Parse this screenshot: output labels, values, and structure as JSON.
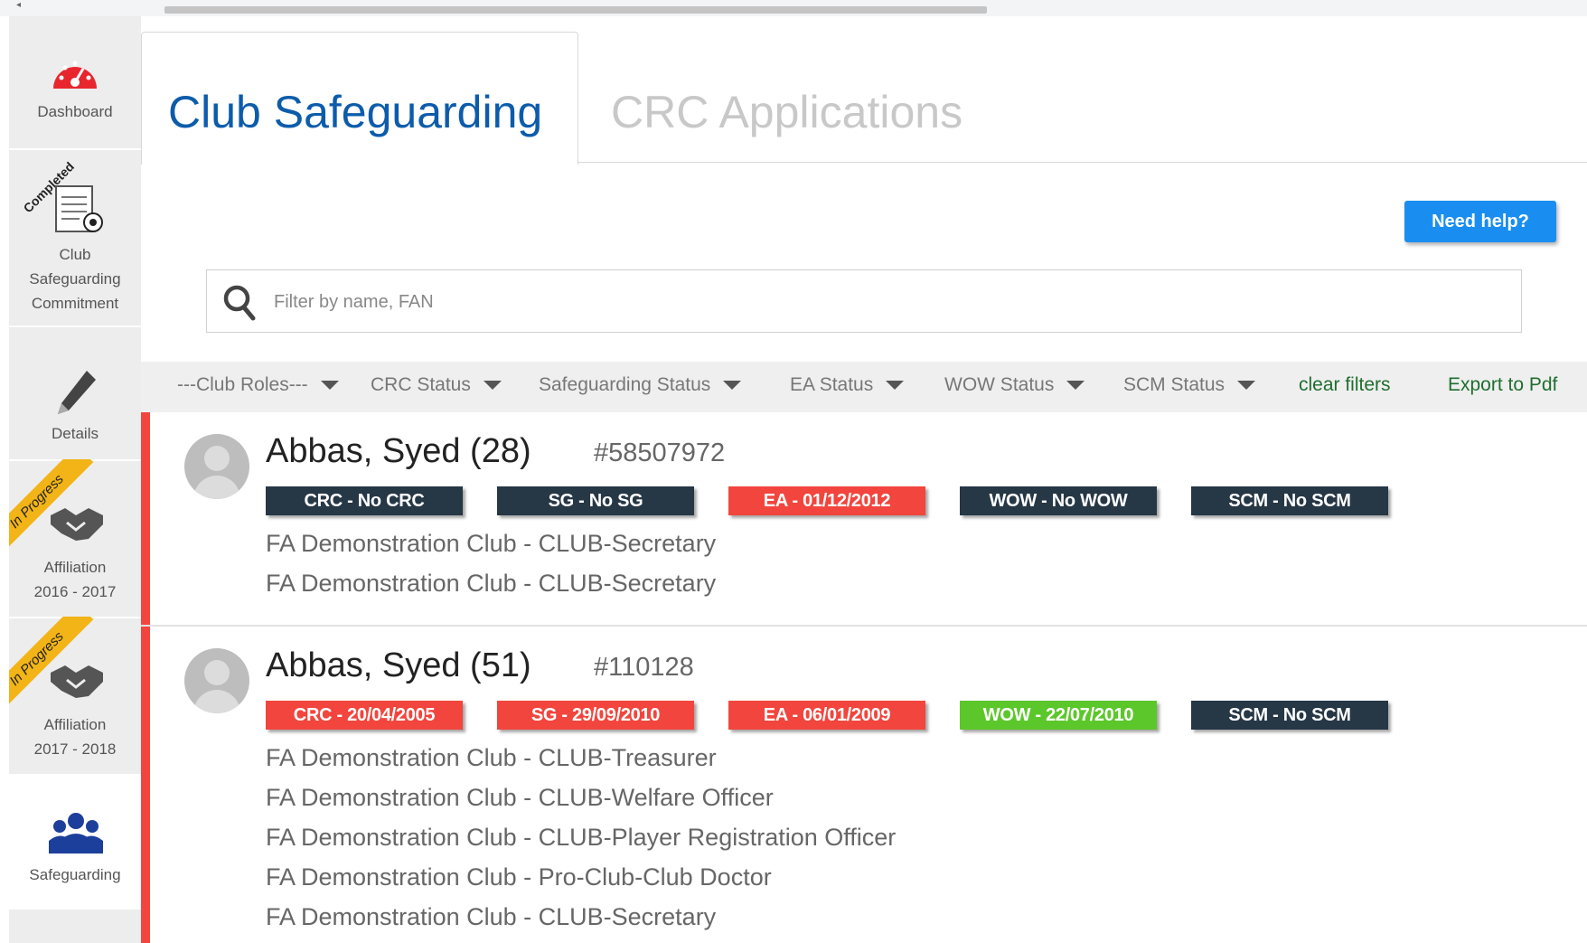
{
  "sidebar": {
    "items": [
      {
        "label": "Dashboard"
      },
      {
        "label_lines": [
          "Club",
          "Safeguarding",
          "Commitment"
        ],
        "status": "Completed"
      },
      {
        "label": "Details"
      },
      {
        "label_lines": [
          "Affiliation",
          "2016 - 2017"
        ],
        "status": "In Progress"
      },
      {
        "label_lines": [
          "Affiliation",
          "2017 - 2018"
        ],
        "status": "In Progress"
      },
      {
        "label": "Safeguarding"
      }
    ]
  },
  "tabs": [
    {
      "label": "Club Safeguarding",
      "active": true
    },
    {
      "label": "CRC Applications",
      "active": false
    }
  ],
  "help_button": "Need help?",
  "search": {
    "placeholder": "Filter by name, FAN",
    "value": ""
  },
  "filters": [
    "---Club Roles---",
    "CRC Status",
    "Safeguarding Status",
    "EA Status",
    "WOW Status",
    "SCM Status"
  ],
  "clear_filters": "clear filters",
  "export": "Export to Pdf",
  "records": [
    {
      "name": "Abbas, Syed (28)",
      "fan": "#58507972",
      "badges": [
        {
          "text": "CRC - No CRC",
          "status": "dark"
        },
        {
          "text": "SG - No SG",
          "status": "dark"
        },
        {
          "text": "EA - 01/12/2012",
          "status": "red"
        },
        {
          "text": "WOW - No WOW",
          "status": "dark"
        },
        {
          "text": "SCM - No SCM",
          "status": "dark"
        }
      ],
      "roles": [
        "FA Demonstration Club - CLUB-Secretary",
        "FA Demonstration Club - CLUB-Secretary"
      ]
    },
    {
      "name": "Abbas, Syed (51)",
      "fan": "#110128",
      "badges": [
        {
          "text": "CRC - 20/04/2005",
          "status": "red"
        },
        {
          "text": "SG - 29/09/2010",
          "status": "red"
        },
        {
          "text": "EA - 06/01/2009",
          "status": "red"
        },
        {
          "text": "WOW - 22/07/2010",
          "status": "green"
        },
        {
          "text": "SCM - No SCM",
          "status": "dark"
        }
      ],
      "roles": [
        "FA Demonstration Club - CLUB-Treasurer",
        "FA Demonstration Club - CLUB-Welfare Officer",
        "FA Demonstration Club - CLUB-Player Registration Officer",
        "FA Demonstration Club - Pro-Club-Club Doctor",
        "FA Demonstration Club - CLUB-Secretary"
      ]
    }
  ],
  "colors": {
    "accent": "#0d5cab",
    "help": "#1a8ef0",
    "status_dark": "#263746",
    "status_red": "#f2453d",
    "status_green": "#5cc72a",
    "ribbon": "#f2b416"
  }
}
